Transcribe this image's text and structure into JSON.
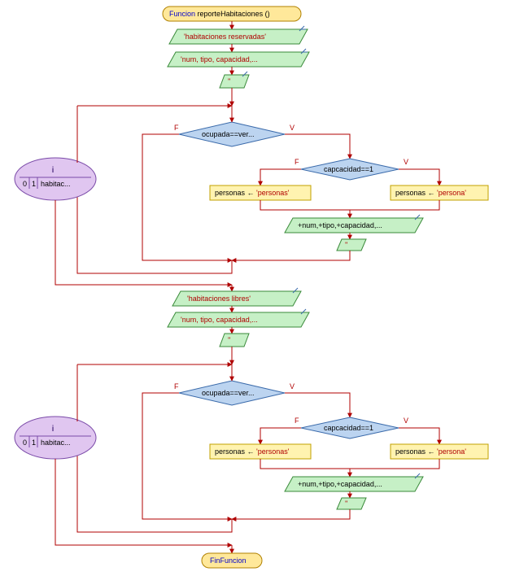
{
  "start_label_kw": "Funcion",
  "start_label_fn": "reporteHabitaciones ()",
  "io_reservadas": "'habitaciones reservadas'",
  "io_headers": "'num, tipo, capacidad,...",
  "io_blank": "''",
  "cond_ocupada": "ocupada==ver...",
  "cond_capacidad": "capcacidad==1",
  "assign_personas_pl": "personas ← 'personas'",
  "assign_personas_sg": "personas ← 'persona'",
  "io_row": "+num,+tipo,+capacidad,...",
  "io_libres": "'habitaciones libres'",
  "end_label": "FinFuncion",
  "loop_var": "i",
  "loop_start": "0",
  "loop_step": "1",
  "loop_end": "habitac...",
  "label_f": "F",
  "label_v": "V",
  "chart_data": {
    "type": "flowchart",
    "title": "Funcion reporteHabitaciones()",
    "nodes": [
      {
        "id": "start",
        "type": "terminal",
        "label": "Funcion reporteHabitaciones ()"
      },
      {
        "id": "io1",
        "type": "io",
        "label": "'habitaciones reservadas'"
      },
      {
        "id": "io2",
        "type": "io",
        "label": "'num, tipo, capacidad,...'"
      },
      {
        "id": "io3",
        "type": "io",
        "label": "''"
      },
      {
        "id": "loop1",
        "type": "for",
        "var": "i",
        "start": 0,
        "step": 1,
        "end": "habitaciones"
      },
      {
        "id": "d1",
        "type": "decision",
        "label": "ocupada==verdadero"
      },
      {
        "id": "d2",
        "type": "decision",
        "label": "capcacidad==1"
      },
      {
        "id": "a1",
        "type": "process",
        "label": "personas ← 'personas'"
      },
      {
        "id": "a2",
        "type": "process",
        "label": "personas ← 'persona'"
      },
      {
        "id": "io4",
        "type": "io",
        "label": "+num,+tipo,+capacidad,..."
      },
      {
        "id": "io5",
        "type": "io",
        "label": "''"
      },
      {
        "id": "io6",
        "type": "io",
        "label": "'habitaciones libres'"
      },
      {
        "id": "io7",
        "type": "io",
        "label": "'num, tipo, capacidad,...'"
      },
      {
        "id": "io8",
        "type": "io",
        "label": "''"
      },
      {
        "id": "loop2",
        "type": "for",
        "var": "i",
        "start": 0,
        "step": 1,
        "end": "habitaciones"
      },
      {
        "id": "d3",
        "type": "decision",
        "label": "ocupada==verdadero"
      },
      {
        "id": "d4",
        "type": "decision",
        "label": "capcacidad==1"
      },
      {
        "id": "a3",
        "type": "process",
        "label": "personas ← 'personas'"
      },
      {
        "id": "a4",
        "type": "process",
        "label": "personas ← 'persona'"
      },
      {
        "id": "io9",
        "type": "io",
        "label": "+num,+tipo,+capacidad,..."
      },
      {
        "id": "io10",
        "type": "io",
        "label": "''"
      },
      {
        "id": "end",
        "type": "terminal",
        "label": "FinFuncion"
      }
    ],
    "edges": [
      [
        "start",
        "io1"
      ],
      [
        "io1",
        "io2"
      ],
      [
        "io2",
        "io3"
      ],
      [
        "io3",
        "loop1.body"
      ],
      [
        "loop1.body",
        "d1"
      ],
      [
        "d1",
        "loop1.next",
        "F"
      ],
      [
        "d1",
        "d2",
        "V"
      ],
      [
        "d2",
        "a1",
        "F"
      ],
      [
        "d2",
        "a2",
        "V"
      ],
      [
        "a1",
        "io4"
      ],
      [
        "a2",
        "io4"
      ],
      [
        "io4",
        "io5"
      ],
      [
        "io5",
        "loop1.next"
      ],
      [
        "loop1.done",
        "io6"
      ],
      [
        "io6",
        "io7"
      ],
      [
        "io7",
        "io8"
      ],
      [
        "io8",
        "loop2.body"
      ],
      [
        "loop2.body",
        "d3"
      ],
      [
        "d3",
        "loop2.next",
        "F"
      ],
      [
        "d3",
        "d4",
        "V"
      ],
      [
        "d4",
        "a3",
        "F"
      ],
      [
        "d4",
        "a4",
        "V"
      ],
      [
        "a3",
        "io9"
      ],
      [
        "a4",
        "io9"
      ],
      [
        "io9",
        "io10"
      ],
      [
        "io10",
        "loop2.next"
      ],
      [
        "loop2.done",
        "end"
      ]
    ]
  }
}
